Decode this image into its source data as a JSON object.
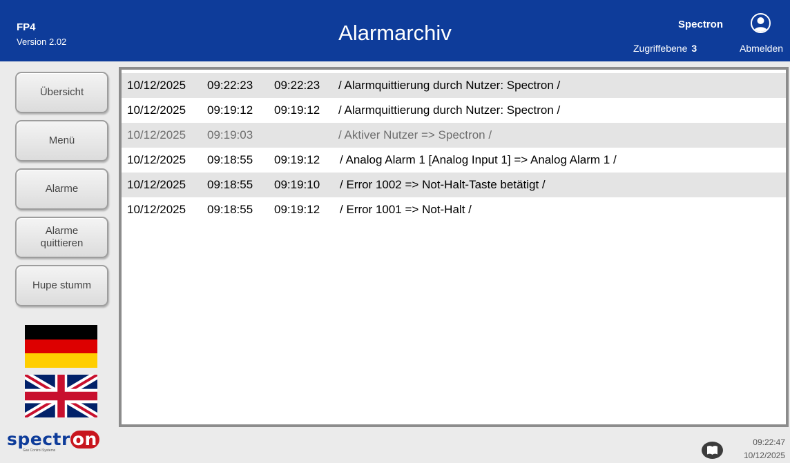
{
  "header": {
    "app_name": "FP4",
    "version": "Version 2.02",
    "title": "Alarmarchiv",
    "user_name": "Spectron",
    "access_label": "Zugriffebene",
    "access_level": "3",
    "logout_label": "Abmelden",
    "user_icon": "user-icon"
  },
  "colors": {
    "header_bg": "#0e3c9a",
    "row_shaded": "#e4e4e4",
    "brand_red": "#c8161e"
  },
  "sidebar": {
    "overview": "Übersicht",
    "menu": "Menü",
    "alarms": "Alarme",
    "acknowledge": "Alarme\nquittieren",
    "horn_mute": "Hupe stumm",
    "languages": [
      "flag-germany-icon",
      "flag-uk-icon"
    ]
  },
  "alarm_log": [
    {
      "date": "10/12/2025",
      "time1": "09:22:23",
      "time2": "09:22:23",
      "message": "/ Alarmquittierung durch Nutzer: Spectron /"
    },
    {
      "date": "10/12/2025",
      "time1": "09:19:12",
      "time2": "09:19:12",
      "message": "/ Alarmquittierung durch Nutzer: Spectron /"
    },
    {
      "date": "10/12/2025",
      "time1": "09:19:03",
      "time2": "",
      "message": "/ Aktiver Nutzer => Spectron /"
    },
    {
      "date": "10/12/2025",
      "time1": "09:18:55",
      "time2": "09:19:12",
      "message": " / Analog Alarm 1 [Analog Input 1] => Analog Alarm 1 /"
    },
    {
      "date": "10/12/2025",
      "time1": "09:18:55",
      "time2": "09:19:10",
      "message": " / Error 1002 => Not-Halt-Taste betätigt /"
    },
    {
      "date": "10/12/2025",
      "time1": "09:18:55",
      "time2": "09:19:12",
      "message": " / Error 1001 => Not-Halt /"
    }
  ],
  "footer": {
    "logo_text": "spectr",
    "logo_highlight": "on",
    "logo_subtitle": "Gas Control Systems",
    "time": "09:22:47",
    "date": "10/12/2025",
    "help_icon": "book-icon"
  }
}
